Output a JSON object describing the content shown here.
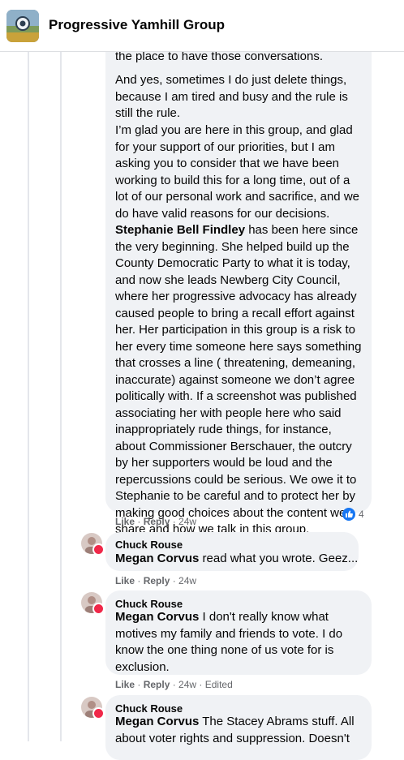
{
  "header": {
    "group_name": "Progressive Yamhill Group"
  },
  "main_comment": {
    "p1_tail": "the place to have those conversations.",
    "p2": [
      "And yes, sometimes I do just delete things,",
      "because I am tired and busy and the rule is",
      "still the rule."
    ],
    "p3_lines": [
      "I’m glad you are here in this group, and glad",
      "for your support of our priorities, but I am",
      "asking you to consider that we have been",
      "working to build this for a long time, out of a",
      "lot of our personal work and sacrifice, and we",
      "do have valid reasons for our decisions."
    ],
    "mention": "Stephanie Bell Findley",
    "mention_rest": " has been here since",
    "p3_more": [
      "the very beginning. She helped build up the",
      "County Democratic Party to what it is today,",
      "and now she leads Newberg City Council,",
      "where her progressive advocacy has already",
      "caused people to bring a recall effort against",
      "her. Her participation in this group is a risk to",
      "her every time someone here says something",
      "that crosses a line ( threatening, demeaning,",
      "inaccurate) against someone we don’t agree",
      "politically with. If a screenshot was published",
      "associating her with people here who said",
      "inappropriately rude things, for instance,",
      "about Commissioner Berschauer, the outcry",
      "by her supporters would be loud and the",
      "repercussions could be serious. We owe it to",
      "Stephanie to be careful and to protect her by",
      "making good choices about the content we",
      "share and how we talk in this group."
    ],
    "like_label": "Like",
    "reply_label": "Reply",
    "time": "24w",
    "reaction_count": "4"
  },
  "replies": [
    {
      "author": "Chuck Rouse",
      "mention": "Megan Corvus",
      "lines": [
        " read what you wrote. Geez..."
      ],
      "like_label": "Like",
      "reply_label": "Reply",
      "time": "24w",
      "edited": ""
    },
    {
      "author": "Chuck Rouse",
      "mention": "Megan Corvus",
      "lines": [
        " I don't really know what",
        "motives my family and friends to vote. I do",
        "know the one thing none of us vote for is",
        "exclusion."
      ],
      "like_label": "Like",
      "reply_label": "Reply",
      "time": "24w",
      "edited": "Edited"
    },
    {
      "author": "Chuck Rouse",
      "mention": "Megan Corvus",
      "lines": [
        " The Stacey Abrams stuff. All",
        "about voter rights and suppression. Doesn't"
      ],
      "like_label": "",
      "reply_label": "",
      "time": "",
      "edited": ""
    }
  ],
  "colors": {
    "bubble": "#f0f2f5",
    "secondary_text": "#65676b",
    "like_blue": "#1877f2",
    "badge_red": "#f02849"
  },
  "icons": [
    "group-avatar-image",
    "like-reaction-icon",
    "user-avatar"
  ]
}
